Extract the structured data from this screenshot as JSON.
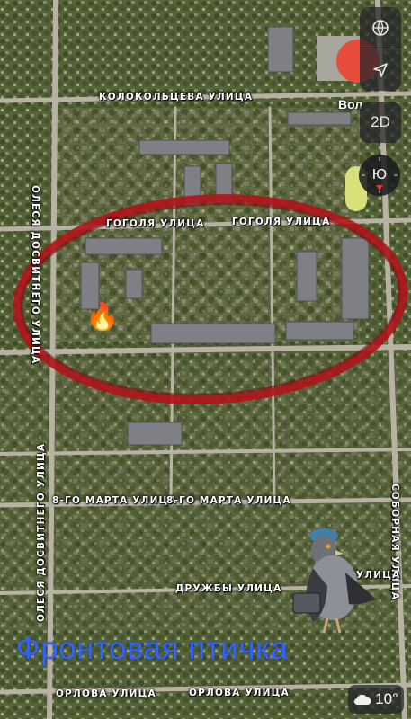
{
  "map": {
    "streets": {
      "kolokoltseva": "КОЛОКОЛЬЦЕВА УЛИЦА",
      "gogolya_1": "ГОГОЛЯ УЛИЦА",
      "gogolya_2": "ГОГОЛЯ УЛИЦА",
      "dosvitnego_1": "ОЛЕСЯ ДОСВИТНЕГО УЛИЦА",
      "dosvitnego_2": "ОЛЕСЯ ДОСВИТНЕГО УЛИЦА",
      "marta_1": "8-ГО МАРТА УЛИЦА",
      "marta_2": "8-ГО МАРТА УЛИЦА",
      "sobornaya": "СОБОРНАЯ УЛИЦА",
      "druzhby": "ДРУЖБЫ УЛИЦА",
      "ulitsa_partial": "УЛИЦА",
      "orlova_1": "ОРЛОВА УЛИЦА",
      "orlova_2": "ОРЛОВА УЛИЦА"
    },
    "place_label": "Вол",
    "marker_emoji": "🔥",
    "highlight_color": "#b0141a"
  },
  "controls": {
    "globe_icon": "globe-icon",
    "locate_icon": "location-arrow-icon",
    "mode_label": "2D",
    "compass_label": "Ю"
  },
  "weather": {
    "icon": "cloud-icon",
    "temperature": "10°"
  },
  "watermark": {
    "text": "Фронтовая птичка",
    "color": "#2f63ff"
  }
}
